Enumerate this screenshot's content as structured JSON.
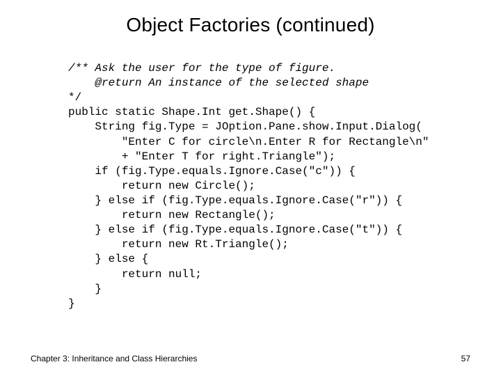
{
  "slide": {
    "title": "Object Factories (continued)",
    "footer_left": "Chapter 3: Inheritance and Class Hierarchies",
    "page_number": "57"
  },
  "code": {
    "line01": "/** Ask the user for the type of figure.",
    "line02": "    @return An instance of the selected shape",
    "line03": "*/",
    "line04": "public static Shape.Int get.Shape() {",
    "line05": "    String fig.Type = JOption.Pane.show.Input.Dialog(",
    "line06": "        \"Enter C for circle\\n.Enter R for Rectangle\\n\"",
    "line07": "        + \"Enter T for right.Triangle\");",
    "line08": "    if (fig.Type.equals.Ignore.Case(\"c\")) {",
    "line09": "        return new Circle();",
    "line10": "    } else if (fig.Type.equals.Ignore.Case(\"r\")) {",
    "line11": "        return new Rectangle();",
    "line12": "    } else if (fig.Type.equals.Ignore.Case(\"t\")) {",
    "line13": "        return new Rt.Triangle();",
    "line14": "    } else {",
    "line15": "        return null;",
    "line16": "    }",
    "line17": "}"
  }
}
